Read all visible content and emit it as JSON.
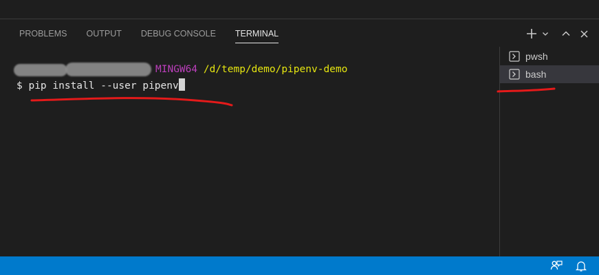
{
  "panel": {
    "tabs": [
      {
        "label": "PROBLEMS"
      },
      {
        "label": "OUTPUT"
      },
      {
        "label": "DEBUG CONSOLE"
      },
      {
        "label": "TERMINAL"
      }
    ],
    "active_tab_index": 3,
    "actions": [
      "plus-icon",
      "chevron-down-icon",
      "chevron-up-icon",
      "close-icon"
    ]
  },
  "terminal": {
    "host": "MINGW64",
    "path": "/d/temp/demo/pipenv-demo",
    "prompt": "$",
    "command": "pip install --user pipenv"
  },
  "terminal_list": {
    "items": [
      {
        "label": "pwsh",
        "icon": "terminal-icon"
      },
      {
        "label": "bash",
        "icon": "terminal-icon"
      }
    ],
    "selected_index": 1
  },
  "status_bar": {
    "icons": [
      "feedback-icon",
      "bell-icon"
    ]
  },
  "colors": {
    "background": "#1e1e1e",
    "status_bar": "#007acc",
    "host": "#bc3fbc",
    "path": "#e5e510",
    "annotation": "#e51a1a"
  }
}
